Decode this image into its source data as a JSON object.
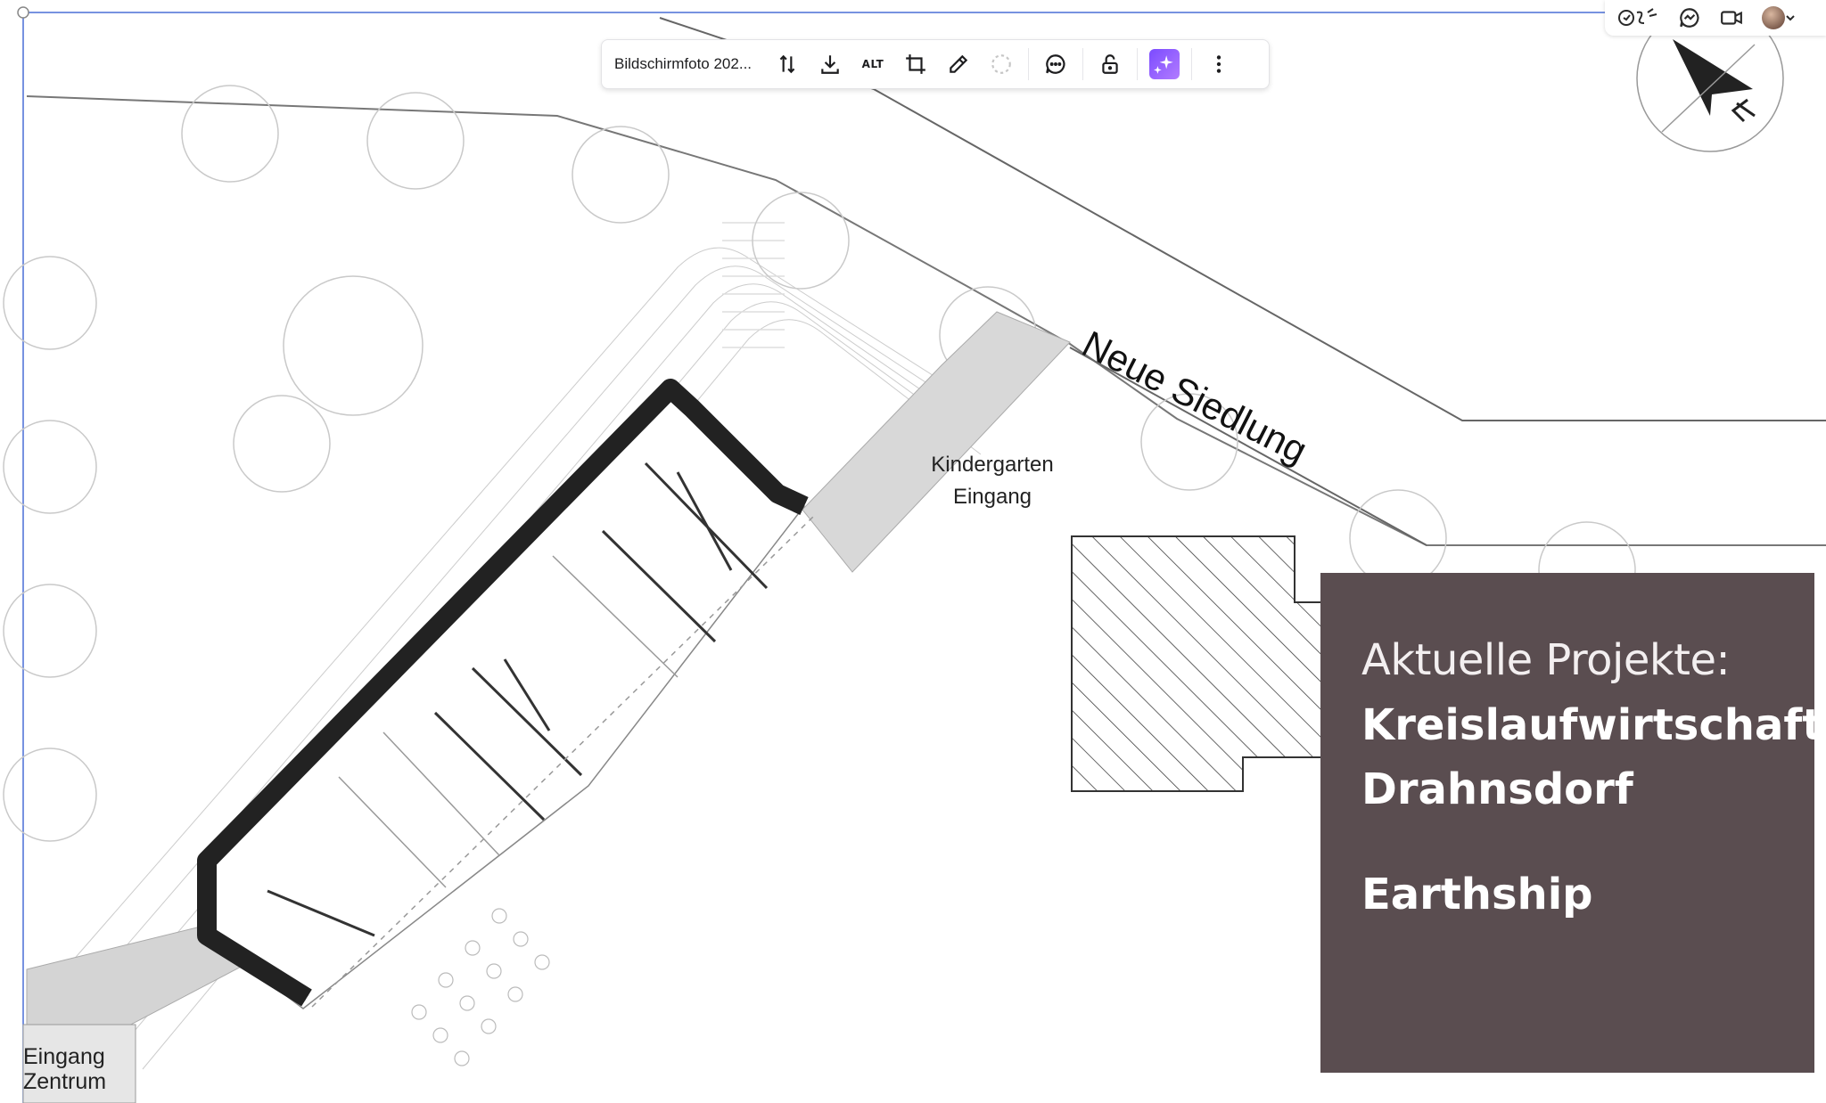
{
  "toolbar": {
    "title": "Bildschirmfoto 202...",
    "alt_label": "ALT",
    "buttons": [
      {
        "icon": "flip-icon"
      },
      {
        "icon": "download-icon"
      },
      {
        "icon": "alt-text"
      },
      {
        "icon": "crop-icon"
      },
      {
        "icon": "pencil-icon"
      },
      {
        "icon": "loading-icon"
      },
      {
        "icon": "comment-icon"
      },
      {
        "icon": "unlock-icon"
      },
      {
        "icon": "magic-icon"
      },
      {
        "icon": "more-icon"
      }
    ]
  },
  "top_right": {
    "icons": [
      "mention-icon",
      "chat-icon",
      "video-icon",
      "avatar"
    ]
  },
  "plan": {
    "street_label": "Neue Siedlung",
    "kindergarten_label_line1": "Kindergarten",
    "kindergarten_label_line2": "Eingang",
    "zentrum_label_line1": "Eingang",
    "zentrum_label_line2": "Zentrum"
  },
  "panel": {
    "heading": "Aktuelle Projekte:",
    "items": [
      "Kreislaufwirtschaft",
      "Drahnsdorf",
      "Earthship"
    ]
  },
  "colors": {
    "panel_bg": "#5a4d50",
    "accent_purple": "#8a5cff",
    "selection_blue": "#4a6fd6"
  }
}
